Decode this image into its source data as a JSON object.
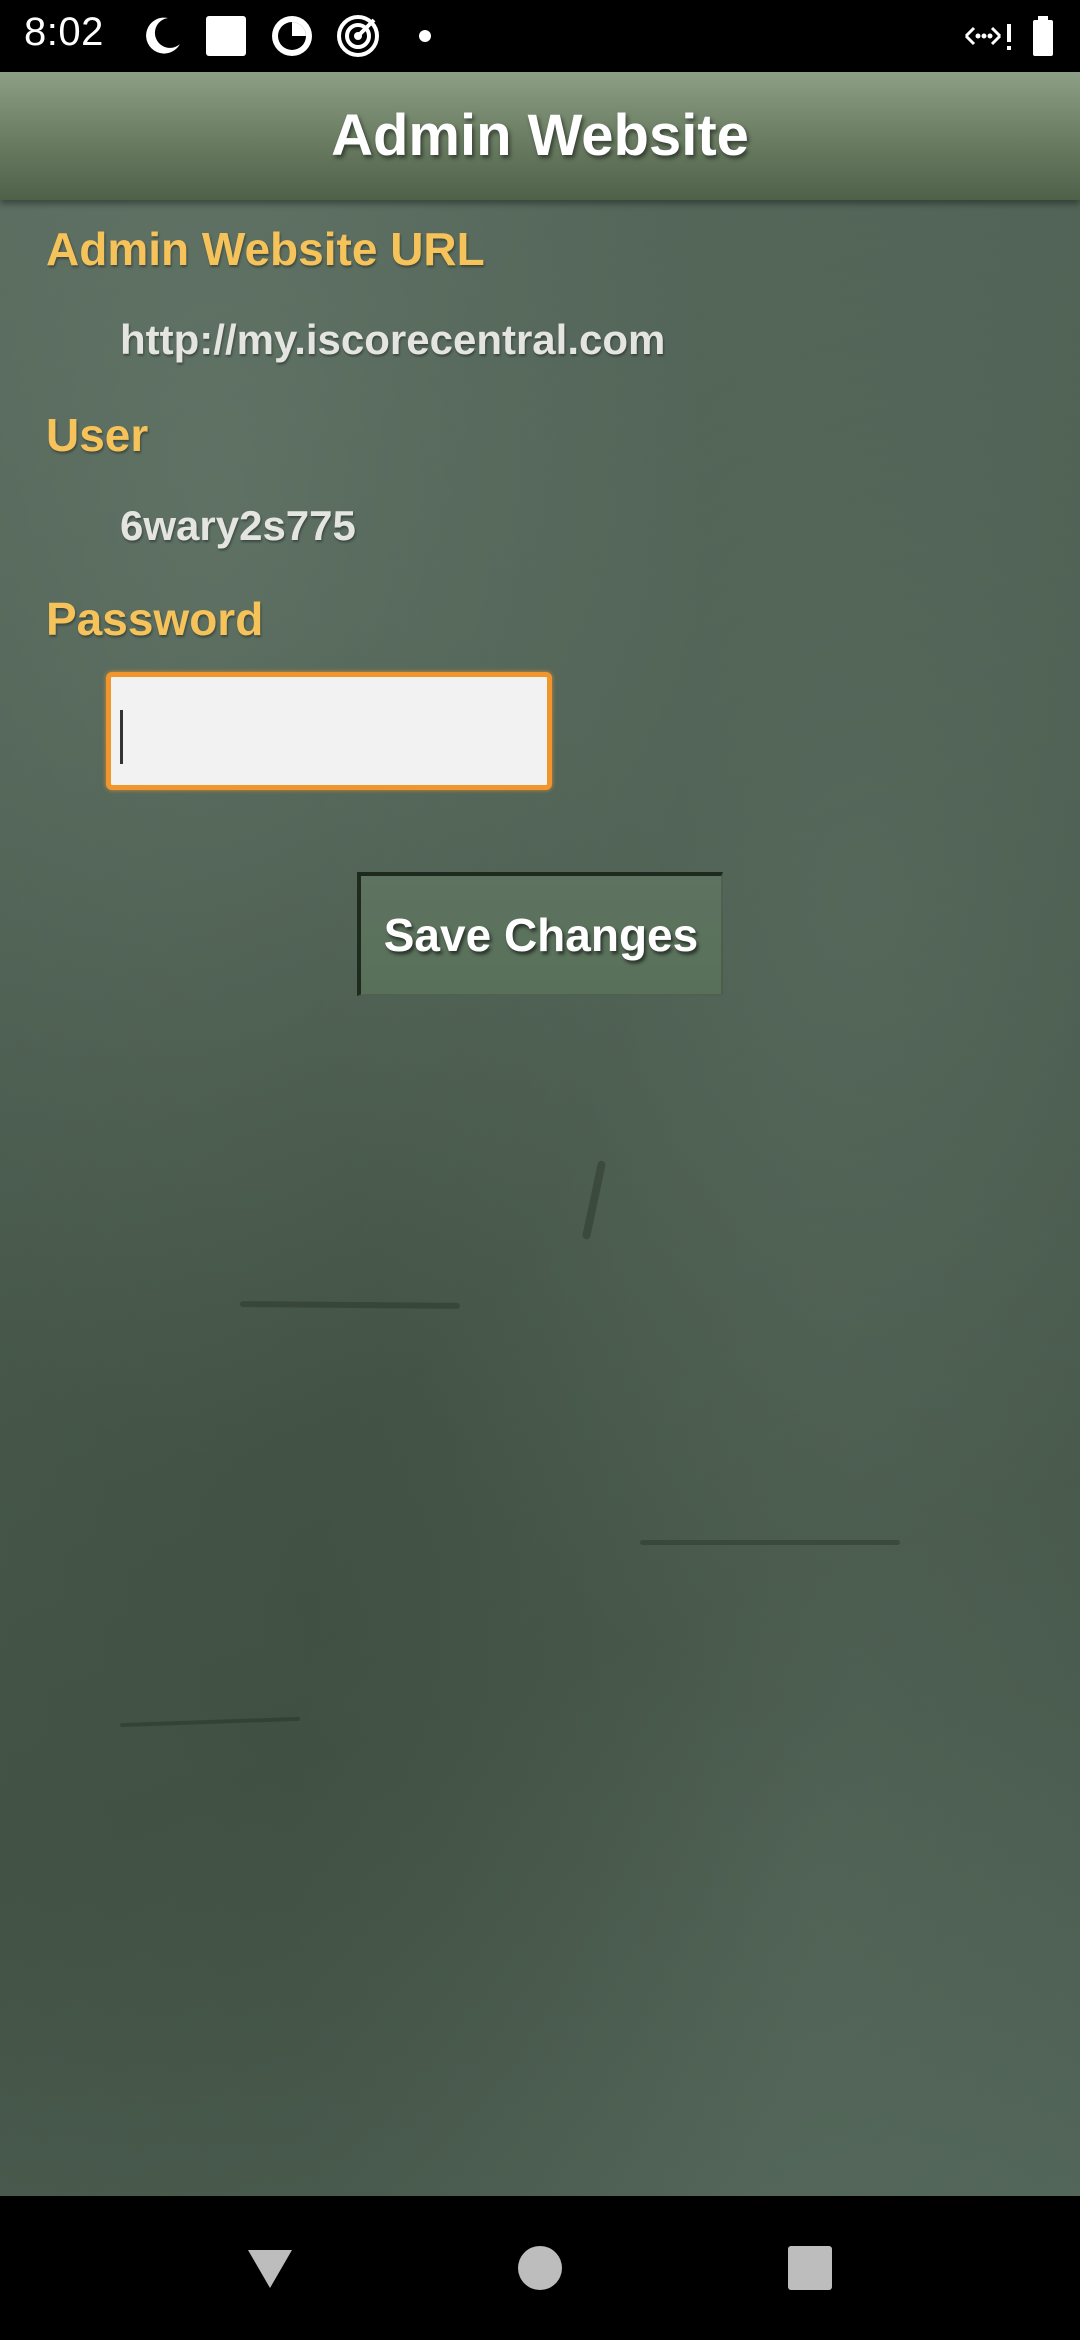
{
  "status_bar": {
    "time": "8:02",
    "icons": [
      "moon-clock-icon",
      "white-square-icon",
      "circle-dial-icon",
      "target-icon",
      "dot-icon",
      "wifi-signal-icon",
      "battery-icon"
    ]
  },
  "header": {
    "title": "Admin Website"
  },
  "form": {
    "url_label": "Admin Website URL",
    "url_value": "http://my.iscorecentral.com",
    "user_label": "User",
    "user_value": "6wary2s775",
    "password_label": "Password",
    "password_value": "",
    "save_button_label": "Save Changes"
  },
  "colors": {
    "label": "#f6c25a",
    "input_border": "#f0962d",
    "header_gradient_top": "#8d9f85",
    "background": "#495a4e"
  },
  "nav_bar": {
    "icons": [
      "back-triangle-icon",
      "home-circle-icon",
      "recents-square-icon"
    ]
  }
}
